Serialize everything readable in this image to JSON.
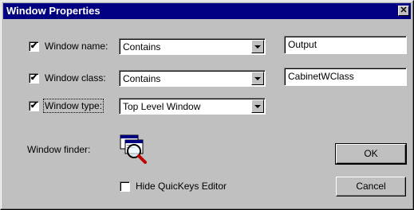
{
  "window": {
    "title": "Window Properties",
    "close_glyph": "✕"
  },
  "rows": [
    {
      "checked": true,
      "check_glyph": "✔",
      "label": "Window name:",
      "operator": "Contains",
      "value": "Output"
    },
    {
      "checked": true,
      "check_glyph": "✔",
      "label": "Window class:",
      "operator": "Contains",
      "value": "CabinetWClass"
    },
    {
      "checked": true,
      "check_glyph": "✔",
      "label": "Window type:",
      "operator": "Top Level Window"
    }
  ],
  "finder": {
    "label": "Window finder:",
    "icon": "window-finder-magnifier-icon"
  },
  "hide_editor": {
    "checked": false,
    "label": "Hide QuicKeys Editor"
  },
  "buttons": {
    "ok": "OK",
    "cancel": "Cancel"
  },
  "colors": {
    "titlebar": "#000080",
    "face": "#c0c0c0"
  }
}
